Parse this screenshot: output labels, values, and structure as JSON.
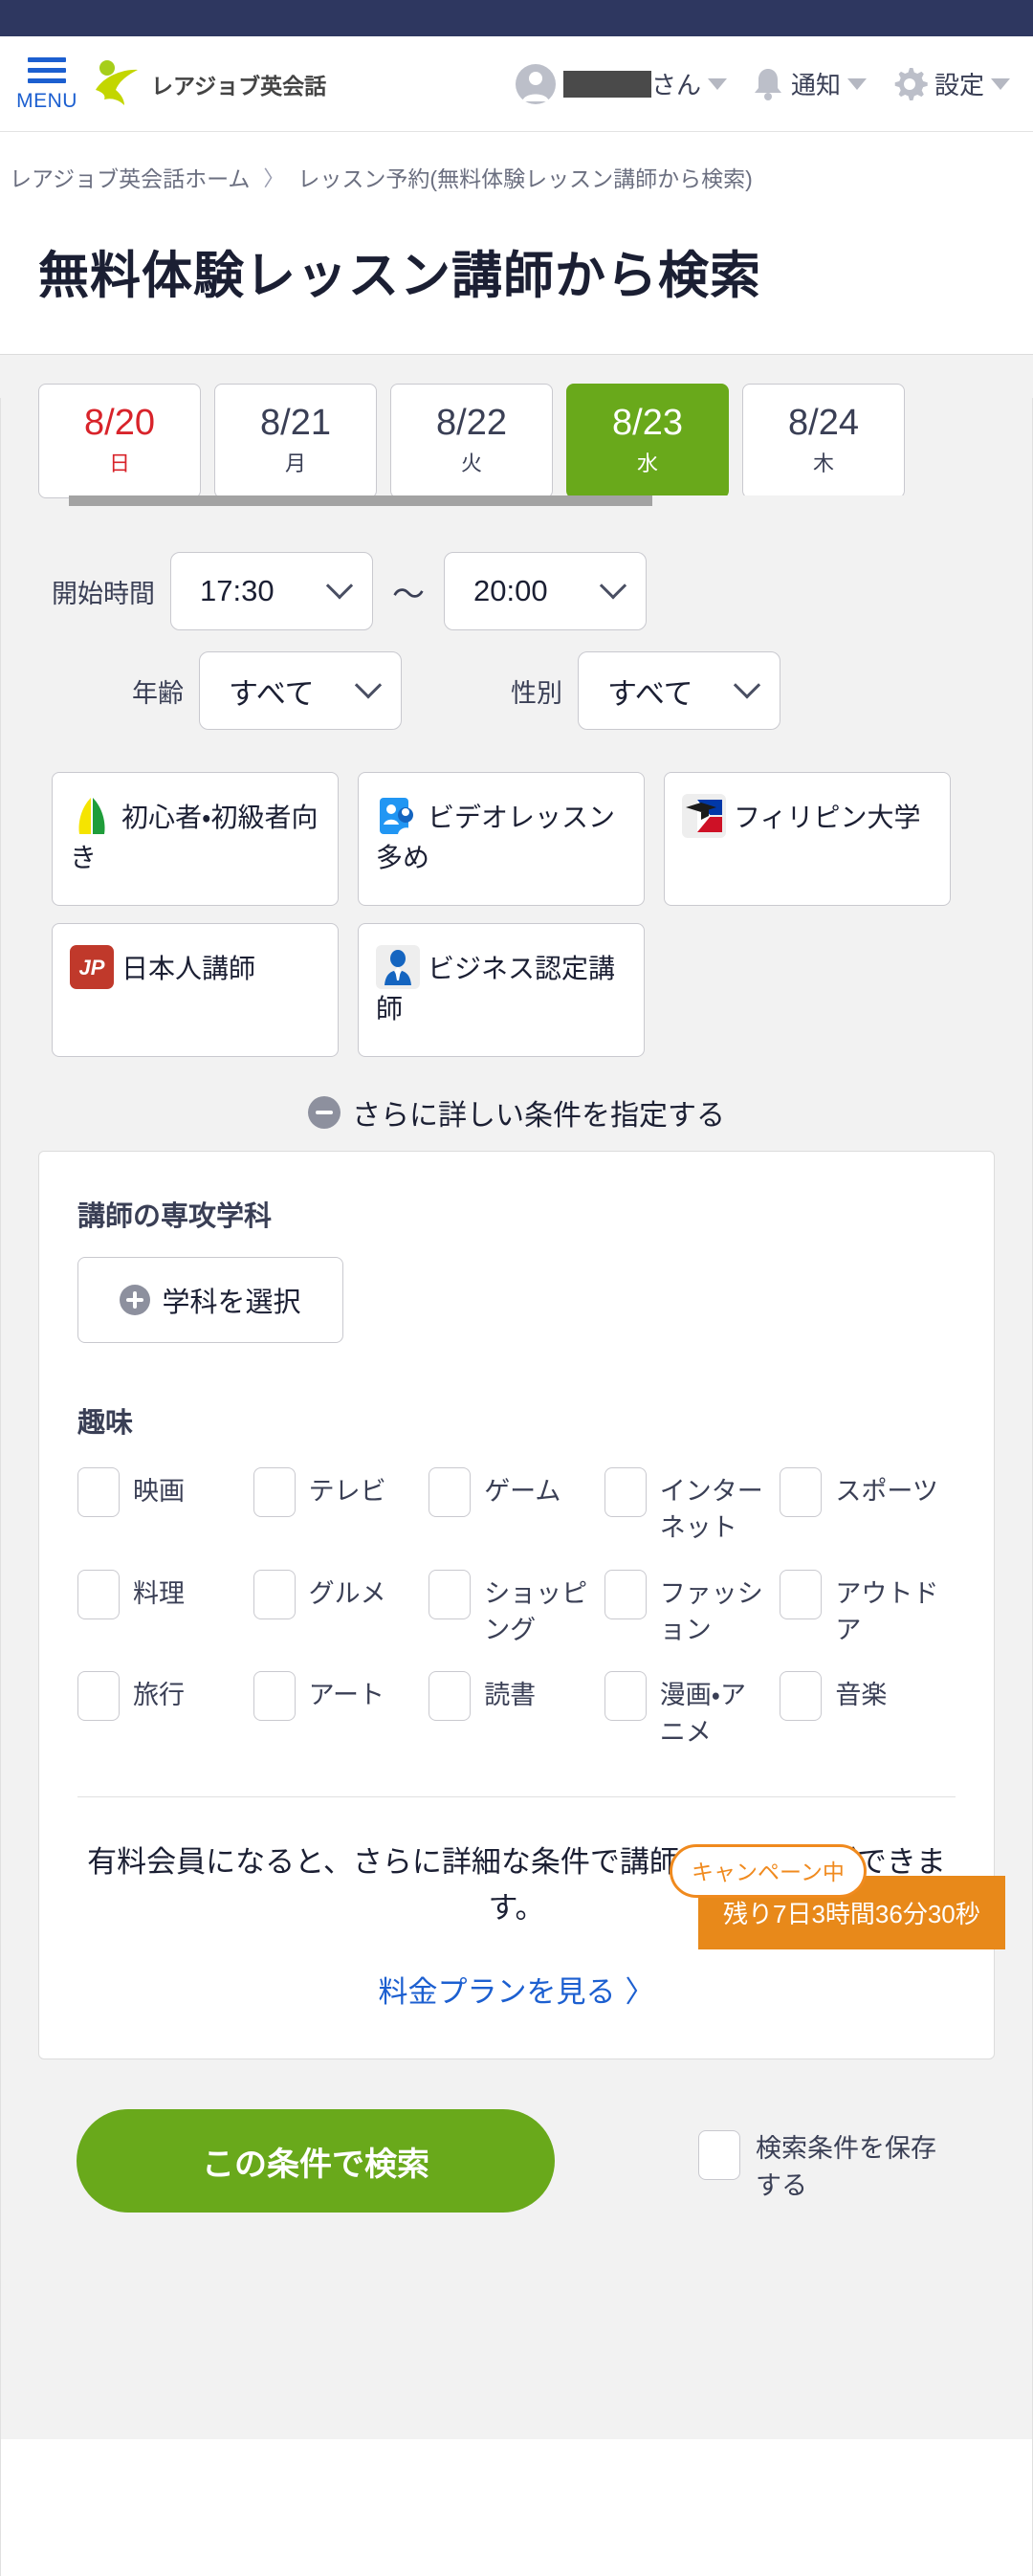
{
  "header": {
    "menu_label": "MENU",
    "brand_text": "レアジョブ英会話",
    "user_name_suffix": "さん",
    "notifications_label": "通知",
    "settings_label": "設定"
  },
  "breadcrumb": {
    "home": "レアジョブ英会話ホーム",
    "separator": "〉",
    "current": "レッスン予約(無料体験レッスン講師から検索)"
  },
  "page_title": "無料体験レッスン講師から検索",
  "dates": [
    {
      "date": "8/20",
      "dow": "日",
      "sunday": true,
      "active": false
    },
    {
      "date": "8/21",
      "dow": "月",
      "sunday": false,
      "active": false
    },
    {
      "date": "8/22",
      "dow": "火",
      "sunday": false,
      "active": false
    },
    {
      "date": "8/23",
      "dow": "水",
      "sunday": false,
      "active": true
    },
    {
      "date": "8/24",
      "dow": "木",
      "sunday": false,
      "active": false
    }
  ],
  "filters": {
    "start_time_label": "開始時間",
    "start_time_value": "17:30",
    "range_sep": "〜",
    "end_time_value": "20:00",
    "age_label": "年齢",
    "age_value": "すべて",
    "gender_label": "性別",
    "gender_value": "すべて"
  },
  "chips": [
    {
      "icon": "beginner-leaf-icon",
      "label": "初心者・初級者向き"
    },
    {
      "icon": "video-lesson-icon",
      "label": "ビデオレッスン多め"
    },
    {
      "icon": "philippines-univ-icon",
      "label": "フィリピン大学"
    },
    {
      "icon": "jp-flag-icon",
      "label": "日本人講師"
    },
    {
      "icon": "business-tutor-icon",
      "label": "ビジネス認定講師"
    }
  ],
  "detail_toggle_label": "さらに詳しい条件を指定する",
  "detail": {
    "major_section_title": "講師の専攻学科",
    "major_button_label": "学科を選択",
    "hobby_section_title": "趣味",
    "hobbies": [
      "映画",
      "テレビ",
      "ゲーム",
      "インターネット",
      "スポーツ",
      "料理",
      "グルメ",
      "ショッピング",
      "ファッション",
      "アウトドア",
      "旅行",
      "アート",
      "読書",
      "漫画・アニメ",
      "音楽"
    ],
    "promo_text": "有料会員になると、さらに詳細な条件で講師を探すことができます。",
    "plan_link_label": "料金プランを見る",
    "plan_link_arrow": "〉"
  },
  "campaign": {
    "badge": "キャンペーン中",
    "countdown": "残り7日3時間36分30秒"
  },
  "bottom": {
    "search_button_label": "この条件で検索",
    "save_condition_label": "検索条件を保存する"
  },
  "colors": {
    "navy": "#2e3760",
    "brand_green": "#69a91b",
    "link_blue": "#1c5fd0",
    "sunday_red": "#d8232a",
    "campaign_orange": "#e8891a",
    "panel_gray": "#f2f2f2"
  }
}
